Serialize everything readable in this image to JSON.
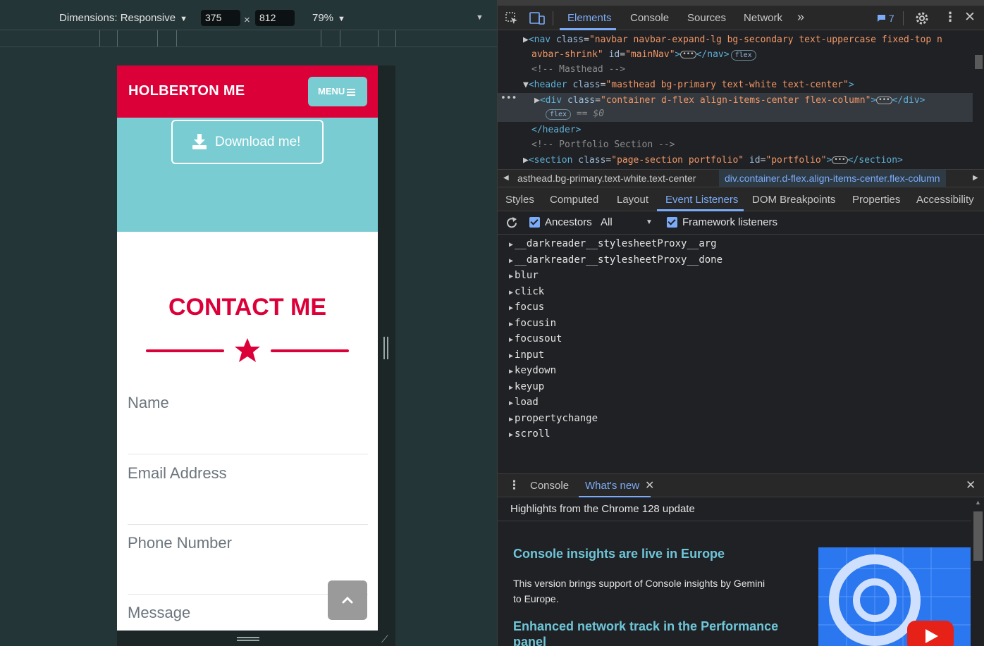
{
  "device_toolbar": {
    "dimensions_label": "Dimensions: Responsive",
    "width": "375",
    "height": "812",
    "times": "×",
    "zoom": "79%"
  },
  "site": {
    "brand": "HOLBERTON ME",
    "menu_label": "MENU",
    "download_label": "Download me!",
    "contact_title": "CONTACT ME",
    "fields": [
      "Name",
      "Email Address",
      "Phone Number",
      "Message"
    ],
    "brand_color": "#dc0039",
    "accent_color": "#79ccd2"
  },
  "devtools": {
    "tabs": [
      "Elements",
      "Console",
      "Sources",
      "Network"
    ],
    "active_tab": "Elements",
    "issues_count": "7",
    "elements_tree": {
      "nav_line_1": "navbar navbar-expand-lg bg-secondary text-uppercase fixed-top n",
      "nav_line_2_attr_tail": "avbar-shrink",
      "nav_id": "mainNav",
      "comment_masthead": "<!-- Masthead -->",
      "header_class": "masthead bg-primary text-white text-center",
      "div_class": "container d-flex align-items-center flex-column",
      "flex_pill": "flex",
      "selected_ref": "== $0",
      "header_close": "</header>",
      "comment_portfolio": "<!-- Portfolio Section -->",
      "section_class": "page-section portfolio",
      "section_id": "portfolio"
    },
    "breadcrumbs": [
      "asthead.bg-primary.text-white.text-center",
      "div.container.d-flex.align-items-center.flex-column"
    ],
    "sub_tabs": [
      "Styles",
      "Computed",
      "Layout",
      "Event Listeners",
      "DOM Breakpoints",
      "Properties",
      "Accessibility"
    ],
    "active_sub_tab": "Event Listeners",
    "event_toolbar": {
      "ancestors_label": "Ancestors",
      "filter_value": "All",
      "framework_label": "Framework listeners"
    },
    "event_listeners": [
      "__darkreader__stylesheetProxy__arg",
      "__darkreader__stylesheetProxy__done",
      "blur",
      "click",
      "focus",
      "focusin",
      "focusout",
      "input",
      "keydown",
      "keyup",
      "load",
      "propertychange",
      "scroll"
    ],
    "drawer": {
      "tabs": [
        "Console",
        "What's new"
      ],
      "active_tab": "What's new",
      "highlights": "Highlights from the Chrome 128 update",
      "h1": "Console insights are live in Europe",
      "p1": "This version brings support of Console insights by Gemini to Europe.",
      "h2": "Enhanced network track in the Performance panel"
    }
  }
}
